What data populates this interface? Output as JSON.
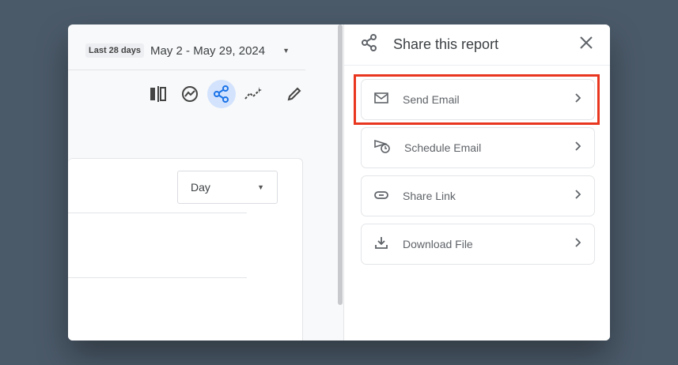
{
  "date": {
    "preset": "Last 28 days",
    "range": "May 2 - May 29, 2024"
  },
  "toolbar": [
    "compare-icon",
    "insights-icon",
    "share-icon",
    "anomaly-icon",
    "edit-icon"
  ],
  "granularity": {
    "selected": "Day"
  },
  "share_panel": {
    "title": "Share this report",
    "options": [
      {
        "label": "Send Email"
      },
      {
        "label": "Schedule Email"
      },
      {
        "label": "Share Link"
      },
      {
        "label": "Download File"
      }
    ]
  },
  "colors": {
    "highlight": "#e8361f",
    "active": "#1a73e8"
  }
}
